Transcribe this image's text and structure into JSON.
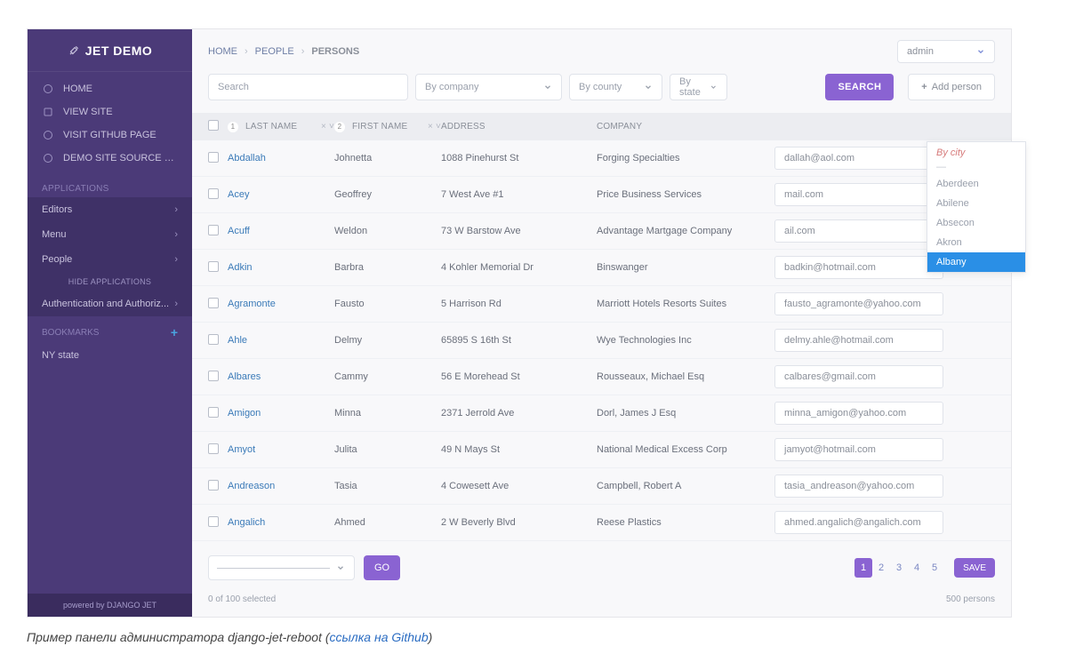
{
  "brand": "JET DEMO",
  "sidebar": {
    "top": [
      {
        "label": "HOME",
        "icon": "home"
      },
      {
        "label": "VIEW SITE",
        "icon": "external"
      },
      {
        "label": "VISIT GITHUB PAGE",
        "icon": "github"
      },
      {
        "label": "DEMO SITE SOURCE CODE",
        "icon": "code"
      }
    ],
    "apps_header": "APPLICATIONS",
    "apps": [
      {
        "label": "Editors"
      },
      {
        "label": "Menu"
      },
      {
        "label": "People"
      }
    ],
    "hide_apps": "HIDE APPLICATIONS",
    "auth_item": "Authentication and Authoriz...",
    "bookmarks_header": "BOOKMARKS",
    "bookmarks": [
      {
        "label": "NY state"
      }
    ],
    "footer": "powered by DJANGO JET"
  },
  "breadcrumbs": [
    "HOME",
    "PEOPLE",
    "PERSONS"
  ],
  "user_menu": "admin",
  "filters": {
    "search_placeholder": "Search",
    "by_company": "By company",
    "by_county": "By county",
    "by_state": "By state",
    "search_btn": "SEARCH",
    "add_btn": "Add person"
  },
  "dropdown": {
    "title": "By city",
    "items": [
      "Aberdeen",
      "Abilene",
      "Absecon",
      "Akron",
      "Albany"
    ],
    "highlight": "Albany"
  },
  "columns": {
    "last": "LAST NAME",
    "first": "FIRST NAME",
    "address": "ADDRESS",
    "company": "COMPANY"
  },
  "rows": [
    {
      "last": "Abdallah",
      "first": "Johnetta",
      "address": "1088 Pinehurst St",
      "company": "Forging Specialties",
      "email": "dallah@aol.com"
    },
    {
      "last": "Acey",
      "first": "Geoffrey",
      "address": "7 West Ave #1",
      "company": "Price Business Services",
      "email": "mail.com"
    },
    {
      "last": "Acuff",
      "first": "Weldon",
      "address": "73 W Barstow Ave",
      "company": "Advantage Martgage Company",
      "email": "ail.com"
    },
    {
      "last": "Adkin",
      "first": "Barbra",
      "address": "4 Kohler Memorial Dr",
      "company": "Binswanger",
      "email": "badkin@hotmail.com"
    },
    {
      "last": "Agramonte",
      "first": "Fausto",
      "address": "5 Harrison Rd",
      "company": "Marriott Hotels Resorts Suites",
      "email": "fausto_agramonte@yahoo.com"
    },
    {
      "last": "Ahle",
      "first": "Delmy",
      "address": "65895 S 16th St",
      "company": "Wye Technologies Inc",
      "email": "delmy.ahle@hotmail.com"
    },
    {
      "last": "Albares",
      "first": "Cammy",
      "address": "56 E Morehead St",
      "company": "Rousseaux, Michael Esq",
      "email": "calbares@gmail.com"
    },
    {
      "last": "Amigon",
      "first": "Minna",
      "address": "2371 Jerrold Ave",
      "company": "Dorl, James J Esq",
      "email": "minna_amigon@yahoo.com"
    },
    {
      "last": "Amyot",
      "first": "Julita",
      "address": "49 N Mays St",
      "company": "National Medical Excess Corp",
      "email": "jamyot@hotmail.com"
    },
    {
      "last": "Andreason",
      "first": "Tasia",
      "address": "4 Cowesett Ave",
      "company": "Campbell, Robert A",
      "email": "tasia_andreason@yahoo.com"
    },
    {
      "last": "Angalich",
      "first": "Ahmed",
      "address": "2 W Beverly Blvd",
      "company": "Reese Plastics",
      "email": "ahmed.angalich@angalich.com"
    }
  ],
  "footer": {
    "go": "GO",
    "save": "SAVE",
    "pages": [
      "1",
      "2",
      "3",
      "4",
      "5"
    ],
    "selected": "0 of 100 selected",
    "total": "500 persons"
  },
  "caption": {
    "prefix": "Пример панели администратора django-jet-reboot (",
    "link": "ссылка на Github",
    "suffix": ")"
  }
}
